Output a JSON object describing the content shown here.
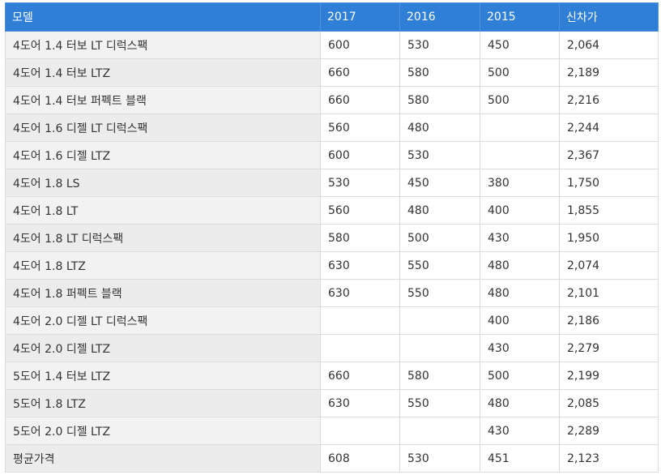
{
  "table": {
    "headers": [
      "모델",
      "2017",
      "2016",
      "2015",
      "신차가"
    ],
    "rows": [
      [
        "4도어 1.4 터보 LT 디럭스팩",
        "600",
        "530",
        "450",
        "2,064"
      ],
      [
        "4도어 1.4 터보 LTZ",
        "660",
        "580",
        "500",
        "2,189"
      ],
      [
        "4도어 1.4 터보 퍼펙트 블랙",
        "660",
        "580",
        "500",
        "2,216"
      ],
      [
        "4도어 1.6 디젤 LT 디럭스팩",
        "560",
        "480",
        "",
        "2,244"
      ],
      [
        "4도어 1.6 디젤 LTZ",
        "600",
        "530",
        "",
        "2,367"
      ],
      [
        "4도어 1.8 LS",
        "530",
        "450",
        "380",
        "1,750"
      ],
      [
        "4도어 1.8 LT",
        "560",
        "480",
        "400",
        "1,855"
      ],
      [
        "4도어 1.8 LT 디럭스팩",
        "580",
        "500",
        "430",
        "1,950"
      ],
      [
        "4도어 1.8 LTZ",
        "630",
        "550",
        "480",
        "2,074"
      ],
      [
        "4도어 1.8 퍼펙트 블랙",
        "630",
        "550",
        "480",
        "2,101"
      ],
      [
        "4도어 2.0 디젤 LT 디럭스팩",
        "",
        "",
        "400",
        "2,186"
      ],
      [
        "4도어 2.0 디젤 LTZ",
        "",
        "",
        "430",
        "2,279"
      ],
      [
        "5도어 1.4 터보 LTZ",
        "660",
        "580",
        "500",
        "2,199"
      ],
      [
        "5도어 1.8 LTZ",
        "630",
        "550",
        "480",
        "2,085"
      ],
      [
        "5도어 2.0 디젤 LTZ",
        "",
        "",
        "430",
        "2,289"
      ],
      [
        "평균가격",
        "608",
        "530",
        "451",
        "2,123"
      ]
    ]
  },
  "colors": {
    "header_bg": "#2f7fd6",
    "header_text": "#ffffff",
    "model_cell_bg": "#f2f2f2",
    "border": "#dcdcdc"
  }
}
